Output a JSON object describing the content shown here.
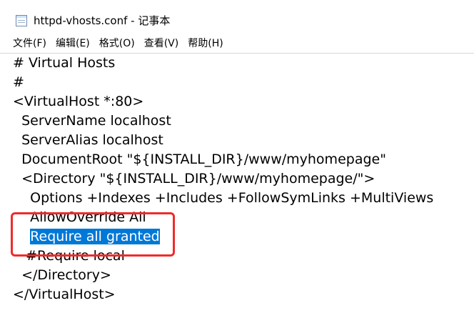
{
  "window": {
    "title": "httpd-vhosts.conf - 记事本",
    "icon": "notepad-icon"
  },
  "menu": {
    "items": [
      "文件(F)",
      "编辑(E)",
      "格式(O)",
      "查看(V)",
      "帮助(H)"
    ]
  },
  "editor": {
    "lines": [
      "# Virtual Hosts",
      "#",
      "<VirtualHost *:80>",
      "  ServerName localhost",
      "  ServerAlias localhost",
      "  DocumentRoot \"${INSTALL_DIR}/www/myhomepage\"",
      "  <Directory \"${INSTALL_DIR}/www/myhomepage/\">",
      "    Options +Indexes +Includes +FollowSymLinks +MultiViews",
      "    AllowOverride All",
      "    Require all granted",
      "   #Require local",
      "  </Directory>",
      "</VirtualHost>"
    ],
    "selected_line": 9,
    "selection_color": "#0078d7",
    "annotation_color": "#f02b2b"
  }
}
